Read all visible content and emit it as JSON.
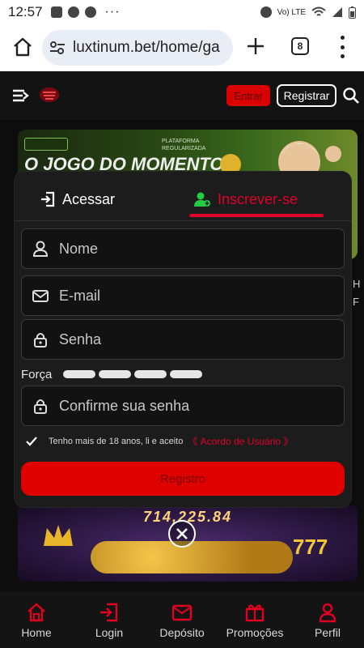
{
  "status_bar": {
    "time": "12:57",
    "notification_icons": [
      "image-icon",
      "messenger-badge-icon",
      "messenger-icon"
    ],
    "overflow": "···",
    "network": "Vo) LTE"
  },
  "browser": {
    "url": "luxtinum.bet/home/ga",
    "tab_count": "8"
  },
  "site_header": {
    "login_label": "Entrar",
    "register_label": "Registrar"
  },
  "banner": {
    "badge_text": "PLATAFORMA REGULARIZADA",
    "title": "O JOGO DO MOMENTO"
  },
  "side_text": [
    "H",
    "F"
  ],
  "modal": {
    "tab_login": "Acessar",
    "tab_register": "Inscrever-se",
    "fields": {
      "name_placeholder": "Nome",
      "email_placeholder": "E-mail",
      "password_placeholder": "Senha",
      "confirm_placeholder": "Confirme sua senha"
    },
    "strength_label": "Força",
    "strength_level": 0,
    "agree_text": "Tenho mais de 18 anos, li e aceito",
    "agree_link": "《 Acordo de Usuário 》",
    "submit_label": "Registro"
  },
  "game_preview": {
    "score": "714,225.84",
    "sevens": "777"
  },
  "bottom_nav": [
    {
      "label": "Home",
      "icon": "home-icon"
    },
    {
      "label": "Login",
      "icon": "login-icon"
    },
    {
      "label": "Depósito",
      "icon": "wallet-icon"
    },
    {
      "label": "Promoções",
      "icon": "gift-icon"
    },
    {
      "label": "Perfil",
      "icon": "person-icon"
    }
  ],
  "colors": {
    "accent_red": "#e0002a",
    "button_red": "#e00000",
    "register_green": "#22cc44"
  }
}
